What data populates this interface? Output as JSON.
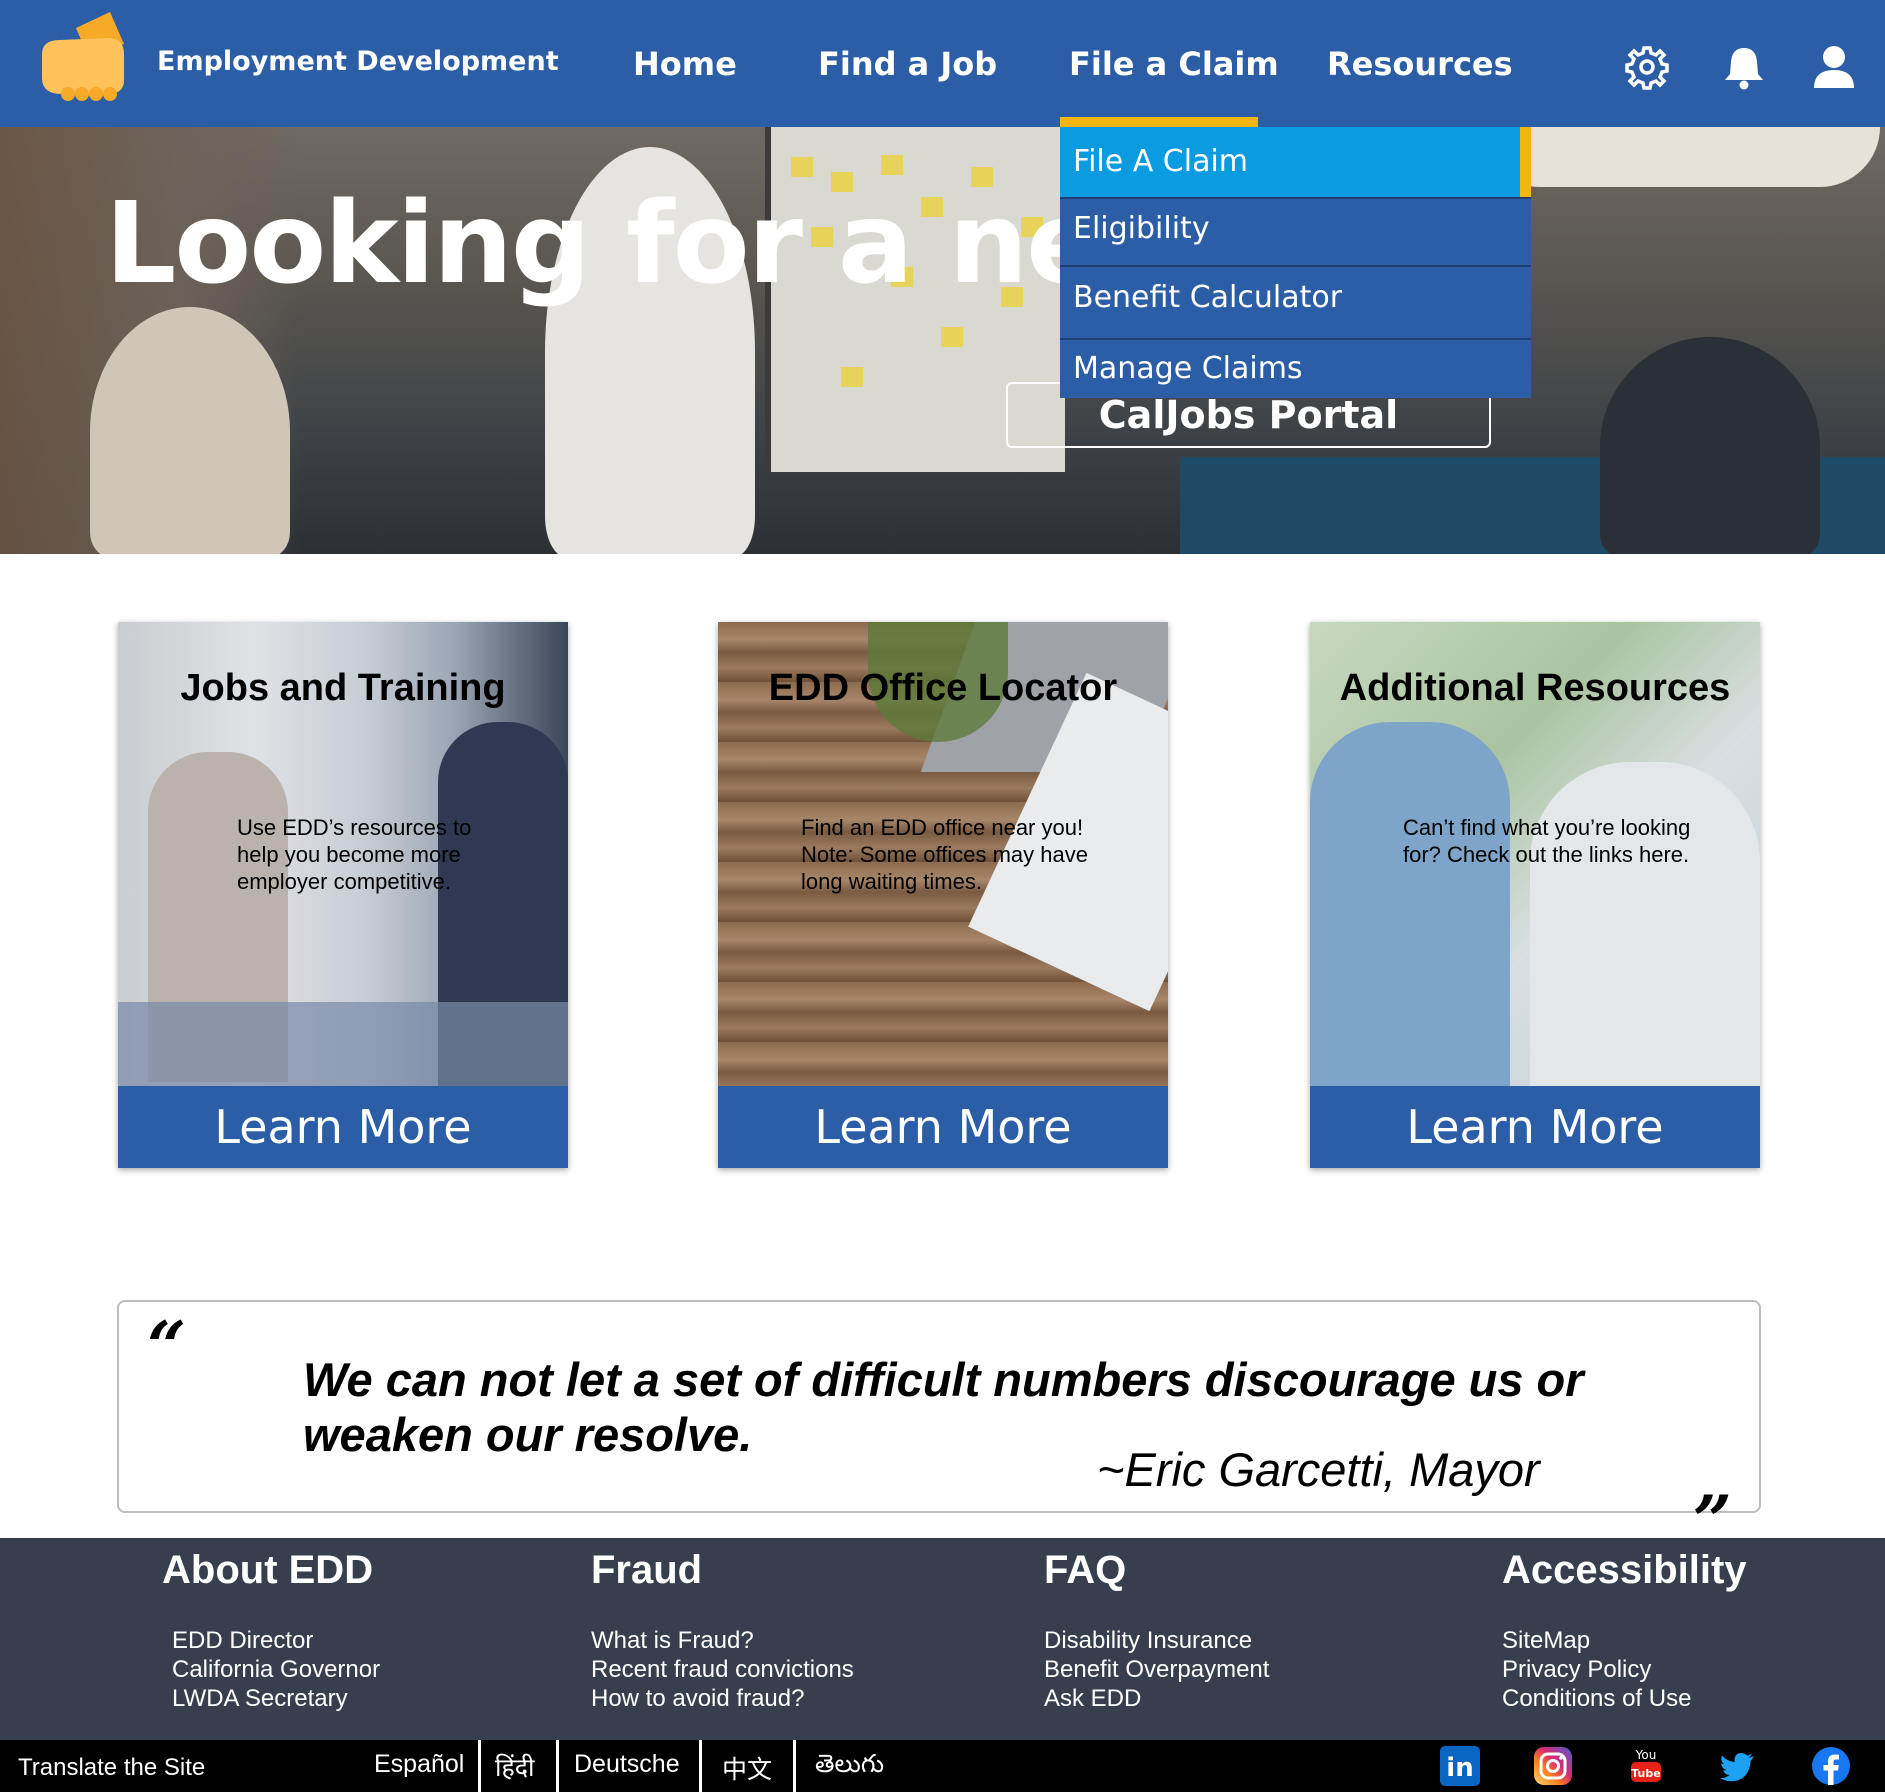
{
  "header": {
    "brand": "Employment Development",
    "nav": [
      "Home",
      "Find a Job",
      "File a Claim",
      "Resources"
    ],
    "active_nav": "File a Claim",
    "icons": [
      "settings-gear-icon",
      "notification-bell-icon",
      "user-profile-icon"
    ]
  },
  "hero": {
    "title": "Looking for a new",
    "cta_label": "CalJobs Portal"
  },
  "dropdown": {
    "items": [
      "File A Claim",
      "Eligibility",
      "Benefit Calculator",
      "Manage Claims"
    ],
    "active_item": "File A Claim"
  },
  "cards": [
    {
      "title": "Jobs and Training",
      "description": "Use EDD’s resources to help you become more employer competitive.",
      "button": "Learn More"
    },
    {
      "title": "EDD Office Locator",
      "description": "Find an EDD office near you! Note: Some offices may have long waiting times.",
      "button": "Learn More"
    },
    {
      "title": "Additional Resources",
      "description": "Can’t find what you’re looking for? Check out the links here.",
      "button": "Learn More"
    }
  ],
  "quote": {
    "open_mark": "“",
    "close_mark": "„",
    "text": "We can not let a set of difficult numbers discourage us or weaken our resolve.",
    "author": "~Eric Garcetti, Mayor"
  },
  "footer": {
    "columns": [
      {
        "title": "About EDD",
        "links": [
          "EDD Director",
          "California Governor",
          "LWDA Secretary"
        ]
      },
      {
        "title": "Fraud",
        "links": [
          "What is Fraud?",
          "Recent fraud convictions",
          "How to avoid fraud?"
        ]
      },
      {
        "title": "FAQ",
        "links": [
          "Disability Insurance",
          "Benefit Overpayment",
          "Ask EDD"
        ]
      },
      {
        "title": "Accessibility",
        "links": [
          "SiteMap",
          "Privacy Policy",
          "Conditions of Use"
        ]
      }
    ]
  },
  "bottombar": {
    "translate_label": "Translate the Site",
    "languages": [
      "Español",
      "हिंदी",
      "Deutsche",
      "中文",
      "తెలుగు"
    ],
    "social_icons": [
      "linkedin-icon",
      "instagram-icon",
      "youtube-icon",
      "twitter-icon",
      "facebook-icon"
    ],
    "social_labels": {
      "linkedin": "in",
      "youtube_top": "You",
      "youtube_bottom": "Tube"
    }
  },
  "colors": {
    "primary_blue": "#2b5ea6",
    "accent_yellow": "#f5b50f",
    "dropdown_active": "#0b9be0",
    "footer_bg": "#373e4d",
    "bottombar_bg": "#000000"
  }
}
